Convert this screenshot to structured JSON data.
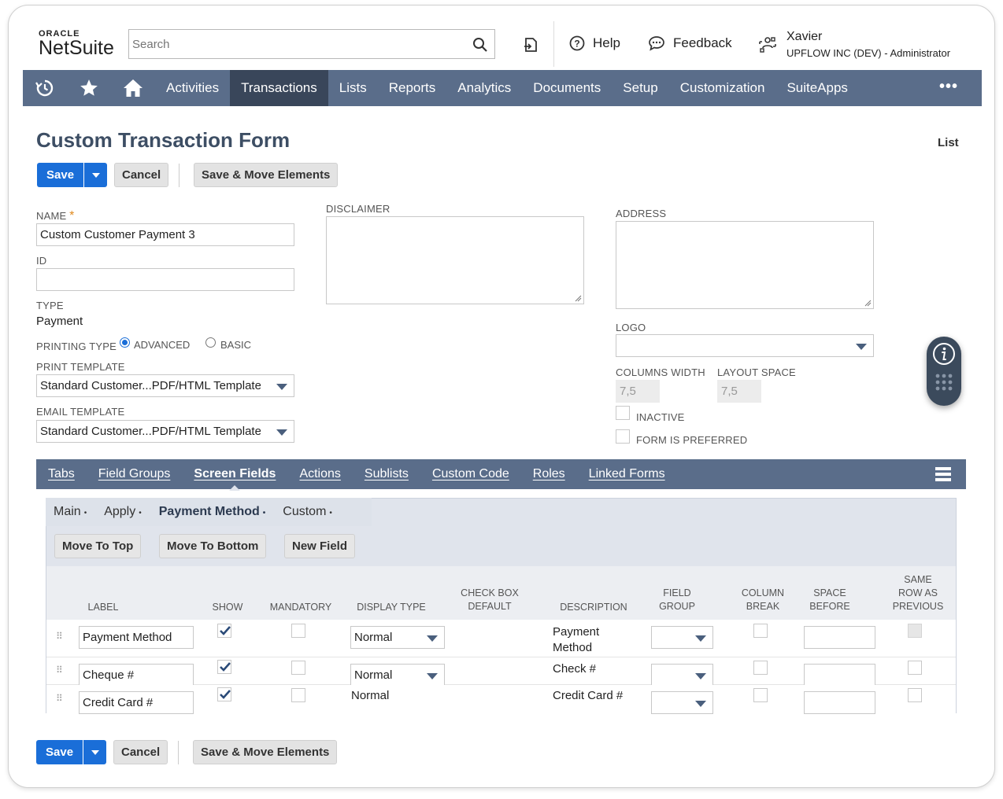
{
  "brand": {
    "oracle": "ORACLE",
    "netsuite": "NetSuite"
  },
  "search": {
    "placeholder": "Search"
  },
  "header": {
    "help": "Help",
    "feedback": "Feedback",
    "user_name": "Xavier",
    "user_role": "UPFLOW INC (DEV) - Administrator"
  },
  "nav": {
    "items": [
      "Activities",
      "Transactions",
      "Lists",
      "Reports",
      "Analytics",
      "Documents",
      "Setup",
      "Customization",
      "SuiteApps"
    ],
    "active": "Transactions",
    "more": "•••"
  },
  "page": {
    "title": "Custom Transaction Form",
    "list_link": "List"
  },
  "buttons": {
    "save": "Save",
    "cancel": "Cancel",
    "save_move": "Save & Move Elements"
  },
  "form": {
    "name_label": "NAME",
    "name_value": "Custom Customer Payment 3",
    "id_label": "ID",
    "id_value": "",
    "type_label": "TYPE",
    "type_value": "Payment",
    "printing_type_label": "PRINTING TYPE",
    "printing_advanced": "ADVANCED",
    "printing_basic": "BASIC",
    "print_template_label": "PRINT TEMPLATE",
    "print_template_value": "Standard Customer...PDF/HTML Template",
    "email_template_label": "EMAIL TEMPLATE",
    "email_template_value": "Standard Customer...PDF/HTML Template",
    "disclaimer_label": "DISCLAIMER",
    "address_label": "ADDRESS",
    "logo_label": "LOGO",
    "columns_width_label": "COLUMNS WIDTH",
    "columns_width_value": "7,5",
    "layout_space_label": "LAYOUT SPACE",
    "layout_space_value": "7,5",
    "inactive_label": "INACTIVE",
    "preferred_label": "FORM IS PREFERRED"
  },
  "subtabs": [
    "Tabs",
    "Field Groups",
    "Screen Fields",
    "Actions",
    "Sublists",
    "Custom Code",
    "Roles",
    "Linked Forms"
  ],
  "subtabs_active": "Screen Fields",
  "inner_tabs": [
    "Main",
    "Apply",
    "Payment Method",
    "Custom"
  ],
  "inner_tabs_active": "Payment Method",
  "panel_buttons": {
    "move_top": "Move To Top",
    "move_bottom": "Move To Bottom",
    "new_field": "New Field"
  },
  "table": {
    "headers": {
      "label": "LABEL",
      "show": "SHOW",
      "mandatory": "MANDATORY",
      "display_type": "DISPLAY TYPE",
      "checkbox_default_1": "CHECK BOX",
      "checkbox_default_2": "DEFAULT",
      "description": "DESCRIPTION",
      "field_group_1": "FIELD",
      "field_group_2": "GROUP",
      "column_break_1": "COLUMN",
      "column_break_2": "BREAK",
      "space_before_1": "SPACE",
      "space_before_2": "BEFORE",
      "same_row_1": "SAME",
      "same_row_2": "ROW AS",
      "same_row_3": "PREVIOUS"
    },
    "rows": [
      {
        "label": "Payment Method",
        "show": true,
        "display_type": "Normal",
        "description_1": "Payment",
        "description_2": "Method"
      },
      {
        "label": "Cheque #",
        "show": true,
        "display_type": "Normal",
        "description_1": "Check #",
        "description_2": ""
      },
      {
        "label": "Credit Card #",
        "show": true,
        "display_type": "Normal",
        "description_1": "Credit Card #",
        "description_2": ""
      }
    ]
  },
  "colors": {
    "nav": "#5a6d8a",
    "nav_active": "#39465a",
    "primary": "#1a6ed8",
    "title": "#3d4e64"
  }
}
